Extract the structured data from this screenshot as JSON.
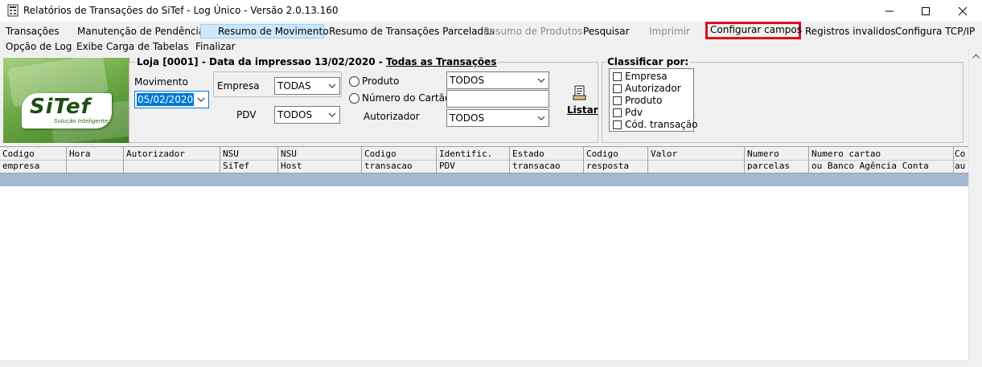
{
  "window": {
    "title": "Relatórios de Transações do SiTef - Log Único - Versão 2.0.13.160"
  },
  "menu": {
    "row1": [
      {
        "label": "Transações",
        "state": "normal"
      },
      {
        "label": "Manutenção de Pendências",
        "state": "normal"
      },
      {
        "label": "Resumo de Movimento",
        "state": "selected"
      },
      {
        "label": "Resumo de Transações Parceladas",
        "state": "normal"
      },
      {
        "label": "Resumo de Produtos",
        "state": "disabled"
      },
      {
        "label": "Pesquisar",
        "state": "normal"
      },
      {
        "label": "Imprimir",
        "state": "disabled"
      },
      {
        "label": "Configurar campos",
        "state": "highlighted"
      },
      {
        "label": "Registros invalidos",
        "state": "normal"
      },
      {
        "label": "Configura TCP/IP",
        "state": "normal"
      }
    ],
    "row2": [
      {
        "label": "Opção de Log",
        "state": "normal"
      },
      {
        "label": "Exibe Carga de Tabelas",
        "state": "normal"
      },
      {
        "label": "Finalizar",
        "state": "normal"
      }
    ]
  },
  "logo": {
    "text": "SiTef",
    "tagline": "Solução Inteligente"
  },
  "filters": {
    "group_title_prefix": "Loja [0001] - Data da impressao 13/02/2020 - ",
    "group_title_mode": "Todas as Transações",
    "movimento_label": "Movimento",
    "movimento_value": "05/02/2020",
    "empresa_label": "Empresa",
    "empresa_value": "TODAS",
    "pdv_label": "PDV",
    "pdv_value": "TODOS",
    "produto_label": "Produto",
    "produto_value": "TODOS",
    "numero_cartao_label": "Número do Cartão",
    "numero_cartao_value": "",
    "autorizador_label": "Autorizador",
    "autorizador_value": "TODOS",
    "listar_label": "Listar"
  },
  "sort": {
    "title": "Classificar por:",
    "options": [
      "Empresa",
      "Autorizador",
      "Produto",
      "Pdv",
      "Cód. transação"
    ]
  },
  "grid": {
    "columns": [
      {
        "line1": "Codigo",
        "line2": "empresa"
      },
      {
        "line1": "Hora",
        "line2": ""
      },
      {
        "line1": "Autorizador",
        "line2": ""
      },
      {
        "line1": "NSU",
        "line2": "SiTef"
      },
      {
        "line1": "NSU",
        "line2": "Host"
      },
      {
        "line1": "Codigo",
        "line2": "transacao"
      },
      {
        "line1": "Identific.",
        "line2": "PDV"
      },
      {
        "line1": "Estado",
        "line2": "transacao"
      },
      {
        "line1": "Codigo",
        "line2": "resposta"
      },
      {
        "line1": "Valor",
        "line2": ""
      },
      {
        "line1": "Numero",
        "line2": "parcelas"
      },
      {
        "line1": "Numero cartao",
        "line2": "ou Banco Agência Conta"
      },
      {
        "line1": "Co",
        "line2": "au"
      }
    ]
  }
}
